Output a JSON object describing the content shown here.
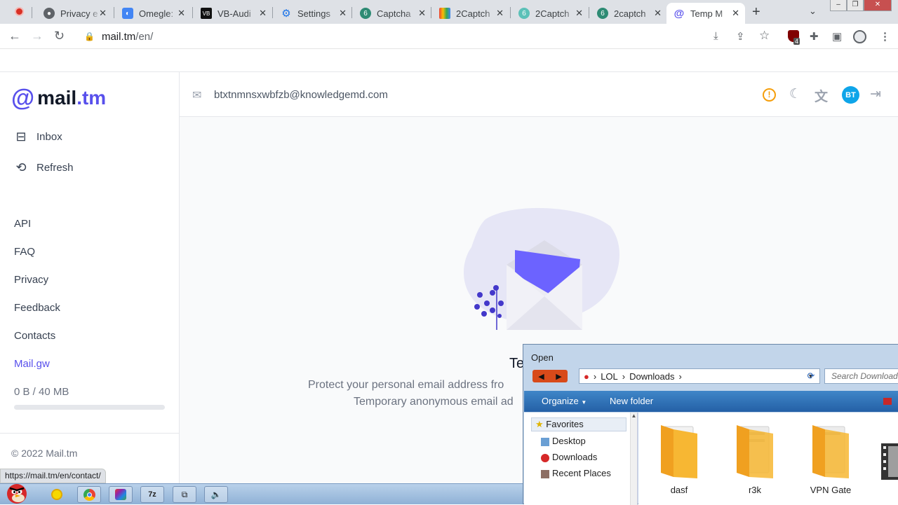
{
  "browser": {
    "tabs": [
      {
        "label": "Privacy e",
        "close": "✕"
      },
      {
        "label": "Omegle:",
        "close": "✕"
      },
      {
        "label": "VB-Audi",
        "close": "✕"
      },
      {
        "label": "Settings",
        "close": "✕"
      },
      {
        "label": "Captcha",
        "close": "✕"
      },
      {
        "label": "2Captch",
        "close": "✕"
      },
      {
        "label": "2Captch",
        "close": "✕"
      },
      {
        "label": "2captch",
        "close": "✕"
      },
      {
        "label": "Temp M",
        "close": "✕"
      }
    ],
    "new_tab": "+",
    "url_host": "mail.tm",
    "url_path": "/en/",
    "extension_badge": "4",
    "status_url": "https://mail.tm/en/contact/"
  },
  "site": {
    "logo_at": "@",
    "logo_name": "mail",
    "logo_tld": ".tm",
    "nav": [
      {
        "label": "Inbox",
        "icon": "inbox-icon"
      },
      {
        "label": "Refresh",
        "icon": "refresh-icon"
      }
    ],
    "links": [
      "API",
      "FAQ",
      "Privacy",
      "Feedback",
      "Contacts",
      "Mail.gw"
    ],
    "quota_text": "0 B  / 40 MB",
    "quota_fraction": 0,
    "copyright": "© 2022 Mail.tm",
    "email": "btxtnmnsxwbfzb@knowledgemd.com",
    "avatar_initials": "BT",
    "empty_heading": "Te",
    "empty_desc_1": "Protect your personal email address fro",
    "empty_desc_2": "Temporary anonymous email ad"
  },
  "dialog": {
    "title": "Open",
    "path": [
      "LOL",
      "Downloads"
    ],
    "search_placeholder": "Search Download",
    "organize": "Organize",
    "new_folder": "New folder",
    "favorites_label": "Favorites",
    "nav_items": [
      "Desktop",
      "Downloads",
      "Recent Places"
    ],
    "files": [
      "dasf",
      "r3k",
      "VPN Gate"
    ]
  },
  "colors": {
    "accent": "#5850ec",
    "avatar": "#0ea5e9",
    "warning": "#f59e0b"
  }
}
